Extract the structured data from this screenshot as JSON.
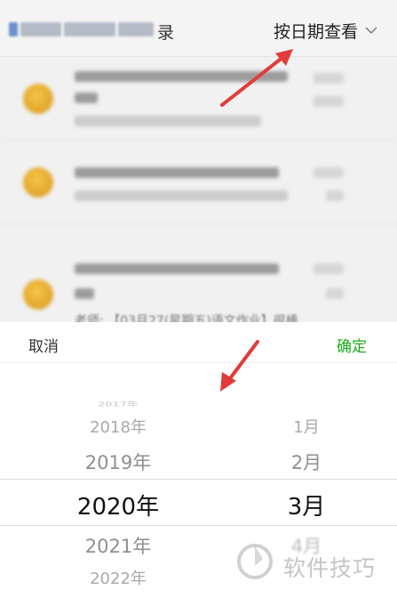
{
  "header": {
    "title_suffix": "录",
    "date_view_label": "按日期查看"
  },
  "background": {
    "partial_text": "老师: 【03月27(星期五)语文作业】很棒"
  },
  "picker": {
    "cancel_label": "取消",
    "confirm_label": "确定",
    "years": [
      "2017年",
      "2018年",
      "2019年",
      "2020年",
      "2021年",
      "2022年"
    ],
    "selected_year": "2020年",
    "months": [
      "1月",
      "2月",
      "3月",
      "4月"
    ],
    "selected_month": "3月"
  },
  "watermark": {
    "text": "软件技巧"
  },
  "colors": {
    "confirm": "#1aad19",
    "annotation_arrow": "#e23b3b"
  }
}
